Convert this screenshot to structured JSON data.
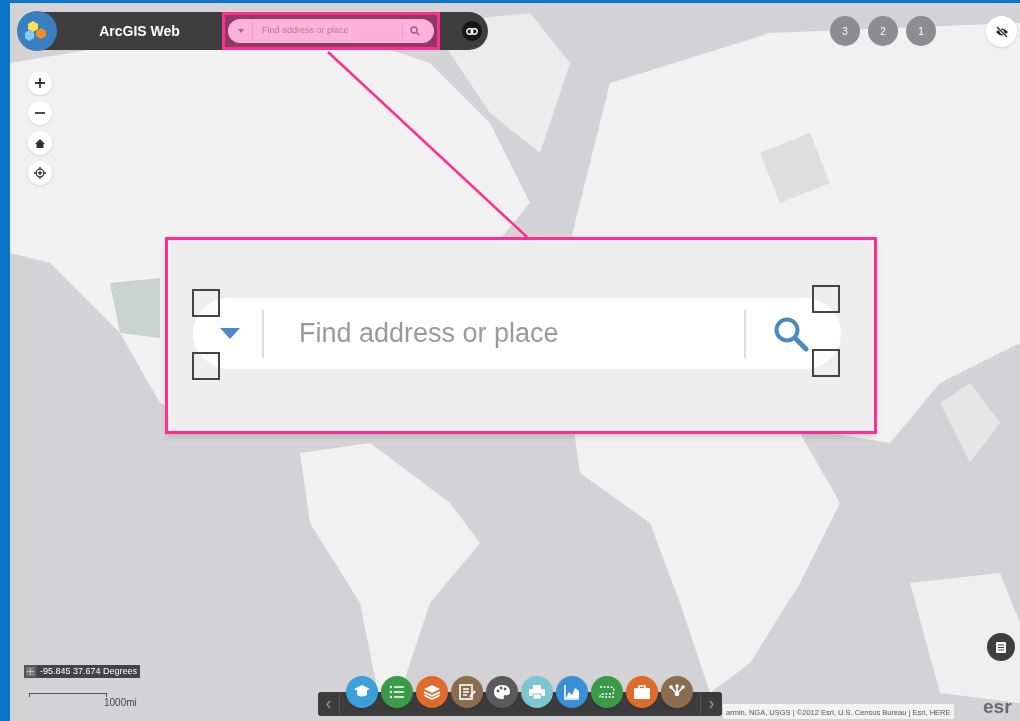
{
  "header": {
    "title": "ArcGIS Web"
  },
  "search": {
    "placeholder": "Find address or place"
  },
  "callout": {
    "placeholder": "Find address or place"
  },
  "badges": [
    "3",
    "2",
    "1"
  ],
  "coordinates": {
    "value": "-95.845 37.674 Degrees"
  },
  "scale": {
    "label": "1000mi"
  },
  "toolbar": {
    "tools": [
      {
        "kind": "cap",
        "color": "#3b9fdc"
      },
      {
        "kind": "list",
        "color": "#3a9a47"
      },
      {
        "kind": "layers",
        "color": "#de6a2c"
      },
      {
        "kind": "note",
        "color": "#8a6d4e"
      },
      {
        "kind": "palette",
        "color": "#5a5a5a"
      },
      {
        "kind": "printer",
        "color": "#7cc4cf"
      },
      {
        "kind": "chart",
        "color": "#3b8fd6"
      },
      {
        "kind": "route",
        "color": "#3a9a47"
      },
      {
        "kind": "briefcase",
        "color": "#de6a2c"
      },
      {
        "kind": "share",
        "color": "#8a6d4e"
      }
    ]
  },
  "attribution": "armin, NGA, USGS | ©2012 Esri, U.S. Census Bureau | Esri, HERE",
  "logo": "esr"
}
